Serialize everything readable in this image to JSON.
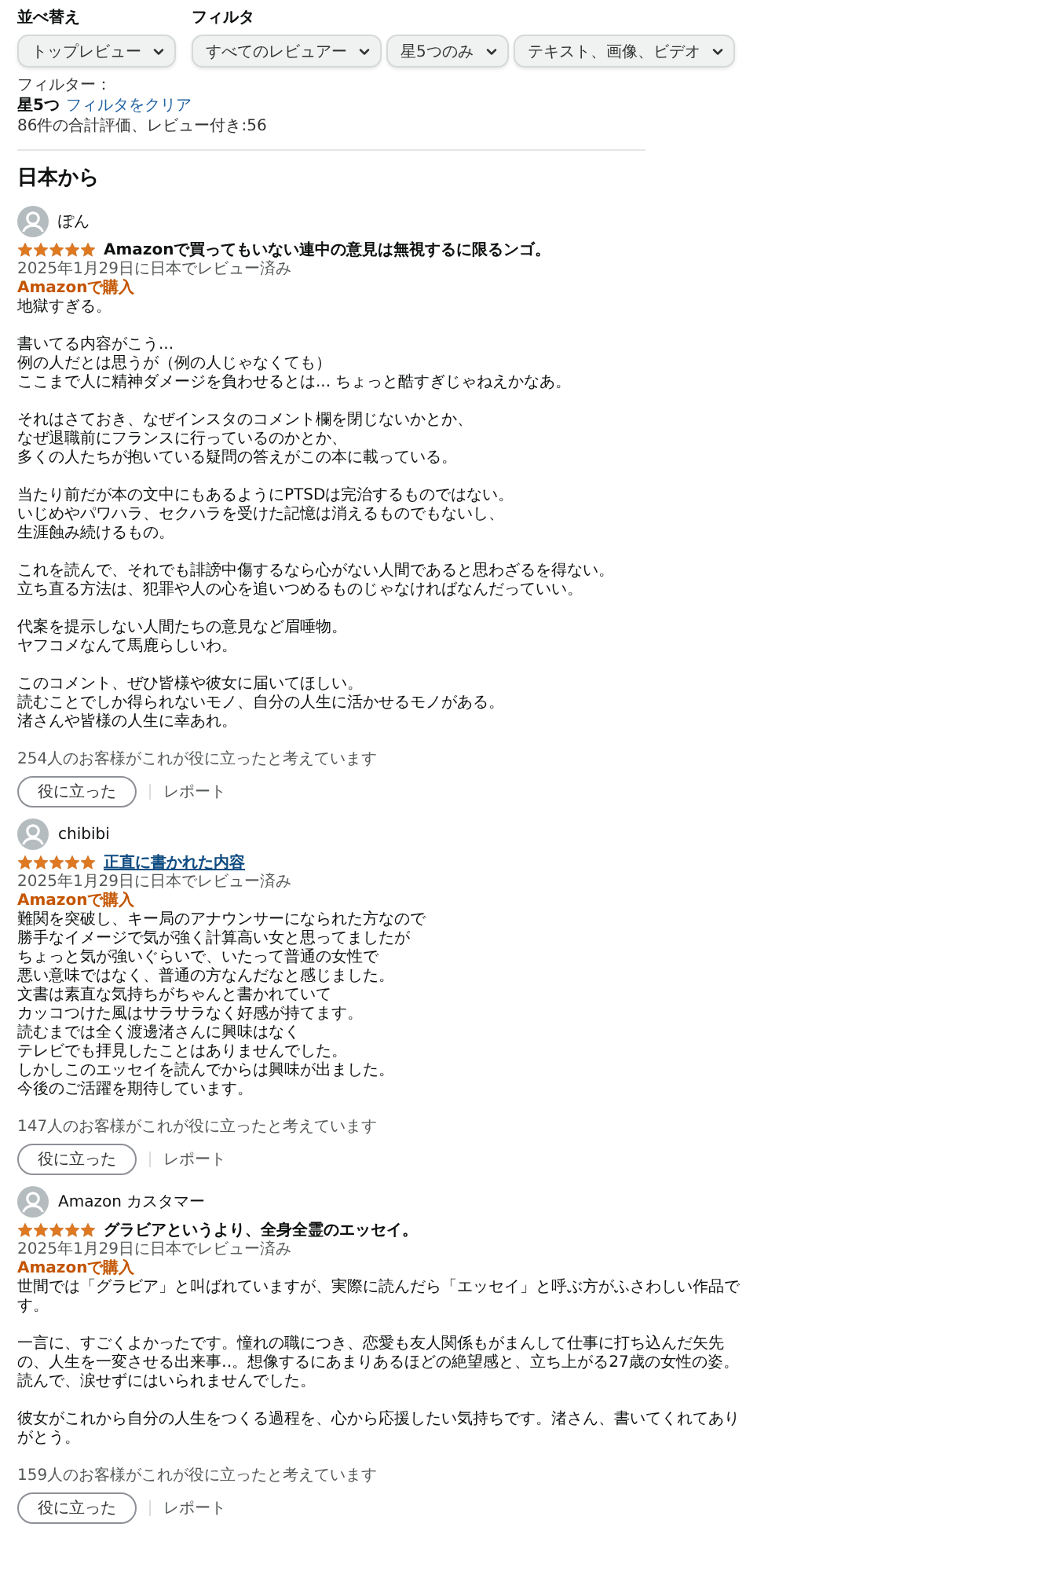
{
  "sort": {
    "label": "並べ替え",
    "dropdowns": [
      {
        "value": "トップレビュー"
      }
    ]
  },
  "filter": {
    "label": "フィルタ",
    "dropdowns": [
      {
        "value": "すべてのレビュアー"
      },
      {
        "value": "星5つのみ"
      },
      {
        "value": "テキスト、画像、ビデオ"
      }
    ]
  },
  "active_filters": {
    "label": "フィルター：",
    "chip": "星5つ",
    "clear_link": "フィルタをクリア"
  },
  "summary": "86件の合計評価、レビュー付き:56",
  "section_title": "日本から",
  "reviews": [
    {
      "author": "ぽん",
      "stars": 5,
      "title": "Amazonで買ってもいない連中の意見は無視するに限るンゴ。",
      "title_underlined": false,
      "date": "2025年1月29日に日本でレビュー済み",
      "badge": "Amazonで購入",
      "paragraphs": [
        [
          "地獄すぎる。"
        ],
        [
          "書いてる内容がこう...",
          "例の人だとは思うが（例の人じゃなくても）",
          "ここまで人に精神ダメージを負わせるとは... ちょっと酷すぎじゃねえかなあ。"
        ],
        [
          "それはさておき、なぜインスタのコメント欄を閉じないかとか、",
          "なぜ退職前にフランスに行っているのかとか、",
          "多くの人たちが抱いている疑問の答えがこの本に載っている。"
        ],
        [
          "当たり前だが本の文中にもあるようにPTSDは完治するものではない。",
          "いじめやパワハラ、セクハラを受けた記憶は消えるものでもないし、",
          "生涯蝕み続けるもの。"
        ],
        [
          "これを読んで、それでも誹謗中傷するなら心がない人間であると思わざるを得ない。",
          "立ち直る方法は、犯罪や人の心を追いつめるものじゃなければなんだっていい。"
        ],
        [
          "代案を提示しない人間たちの意見など眉唾物。",
          "ヤフコメなんて馬鹿らしいわ。"
        ],
        [
          "このコメント、ぜひ皆様や彼女に届いてほしい。",
          "読むことでしか得られないモノ、自分の人生に活かせるモノがある。",
          "渚さんや皆様の人生に幸あれ。"
        ]
      ],
      "helpful": "254人のお客様がこれが役に立ったと考えています",
      "helpful_button": "役に立った",
      "report": "レポート"
    },
    {
      "author": "chibibi",
      "stars": 5,
      "title": "正直に書かれた内容",
      "title_underlined": true,
      "date": "2025年1月29日に日本でレビュー済み",
      "badge": "Amazonで購入",
      "paragraphs": [
        [
          "難関を突破し、キー局のアナウンサーになられた方なので",
          "勝手なイメージで気が強く計算高い女と思ってましたが",
          "ちょっと気が強いぐらいで、いたって普通の女性で",
          "悪い意味ではなく、普通の方なんだなと感じました。",
          "文書は素直な気持ちがちゃんと書かれていて",
          "カッコつけた風はサラサラなく好感が持てます。",
          "読むまでは全く渡邊渚さんに興味はなく",
          "テレビでも拝見したことはありませんでした。",
          "しかしこのエッセイを読んでからは興味が出ました。",
          "今後のご活躍を期待しています。"
        ]
      ],
      "helpful": "147人のお客様がこれが役に立ったと考えています",
      "helpful_button": "役に立った",
      "report": "レポート"
    },
    {
      "author": "Amazon カスタマー",
      "stars": 5,
      "title": "グラビアというより、全身全霊のエッセイ。",
      "title_underlined": false,
      "date": "2025年1月29日に日本でレビュー済み",
      "badge": "Amazonで購入",
      "paragraphs": [
        [
          "世間では「グラビア」と叫ばれていますが、実際に読んだら「エッセイ」と呼ぶ方がふさわしい作品で",
          "す。"
        ],
        [
          "一言に、すごくよかったです。憧れの職につき、恋愛も友人関係もがまんして仕事に打ち込んだ矢先",
          "の、人生を一変させる出来事‥。想像するにあまりあるほどの絶望感と、立ち上がる27歳の女性の姿。",
          "読んで、涙せずにはいられませんでした。"
        ],
        [
          "彼女がこれから自分の人生をつくる過程を、心から応援したい気持ちです。渚さん、書いてくれてあり",
          "がとう。"
        ]
      ],
      "helpful": "159人のお客様がこれが役に立ったと考えています",
      "helpful_button": "役に立った",
      "report": "レポート"
    }
  ]
}
